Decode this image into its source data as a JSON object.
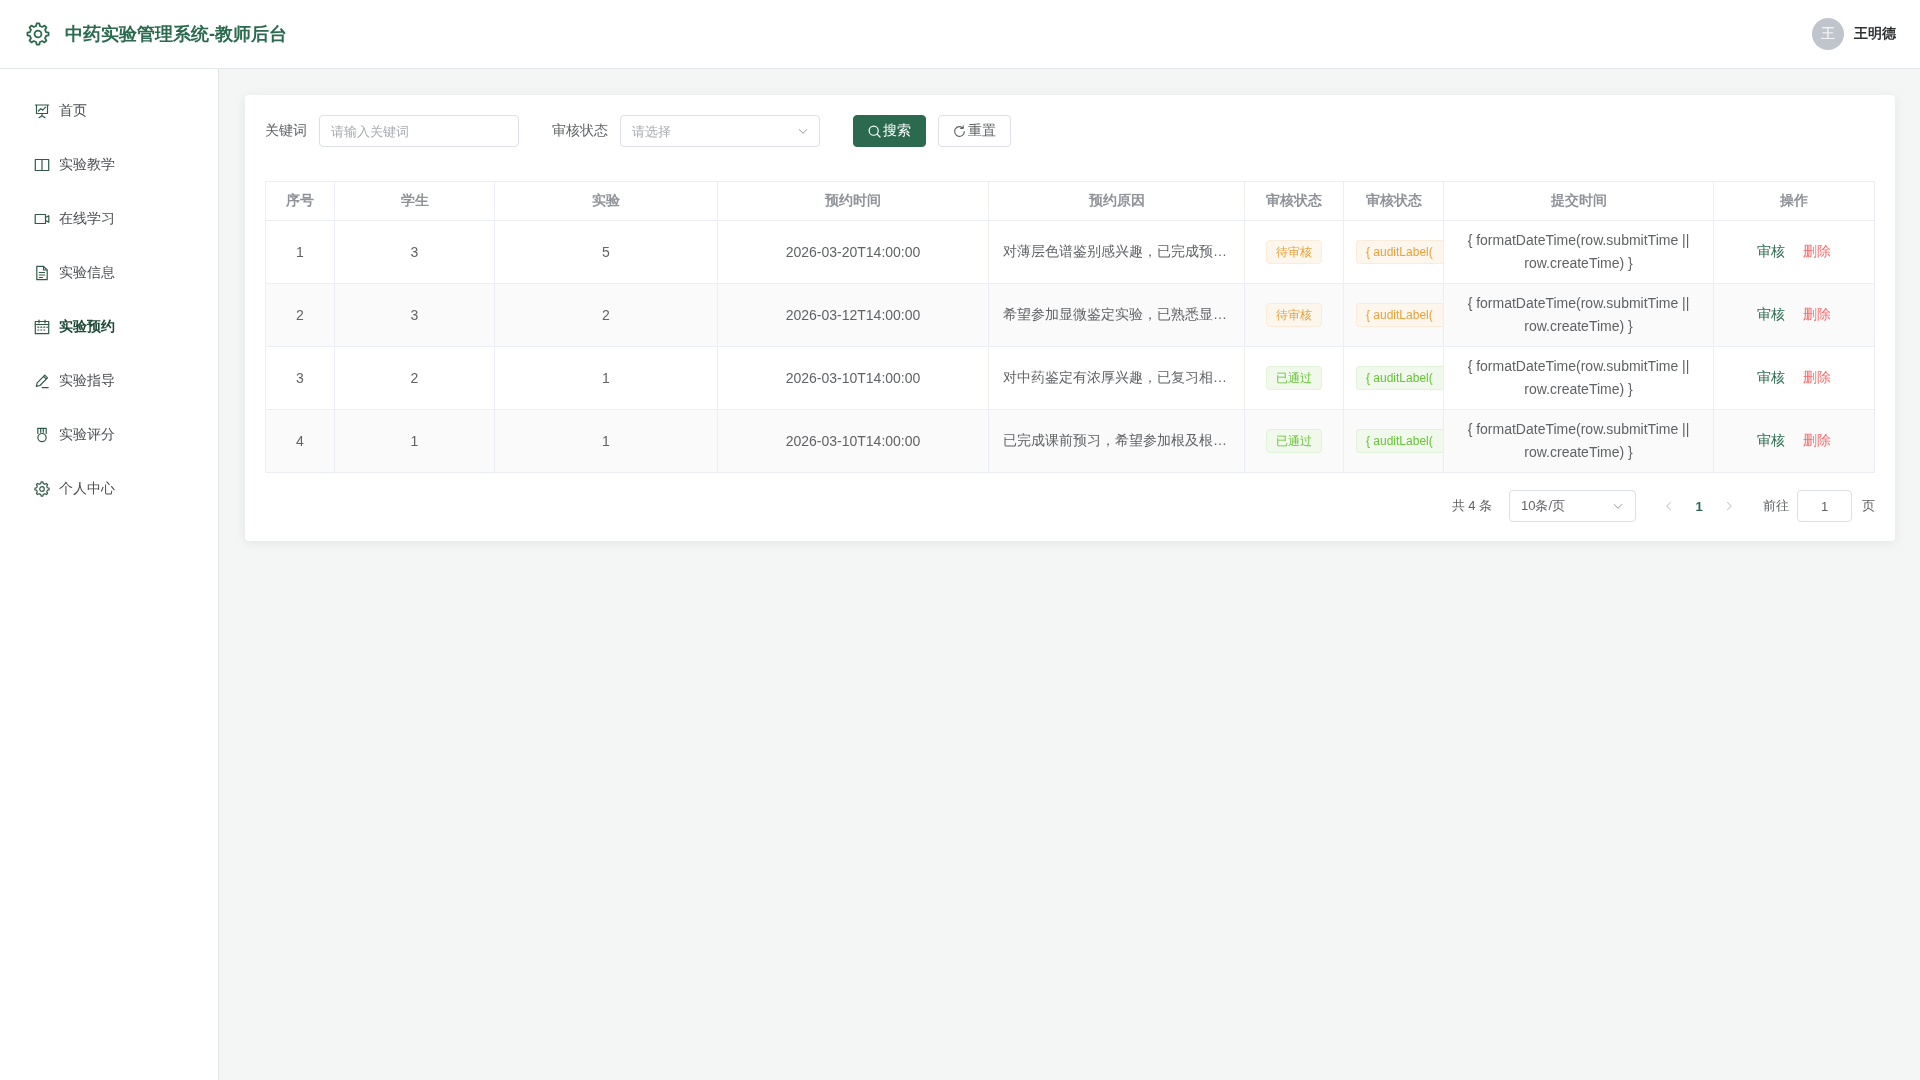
{
  "header": {
    "title": "中药实验管理系统-教师后台",
    "user": {
      "avatar_initial": "王",
      "name": "王明德"
    }
  },
  "sidebar": {
    "items": [
      {
        "label": "首页",
        "selected": false
      },
      {
        "label": "实验教学",
        "selected": false
      },
      {
        "label": "在线学习",
        "selected": false
      },
      {
        "label": "实验信息",
        "selected": false
      },
      {
        "label": "实验预约",
        "selected": true
      },
      {
        "label": "实验指导",
        "selected": false
      },
      {
        "label": "实验评分",
        "selected": false
      },
      {
        "label": "个人中心",
        "selected": false
      }
    ]
  },
  "filters": {
    "keyword": {
      "label": "关键词",
      "placeholder": "请输入关键词"
    },
    "audit_status": {
      "label": "审核状态",
      "placeholder": "请选择"
    },
    "buttons": [
      {
        "label": "搜索",
        "kind": "search"
      },
      {
        "label": "重置",
        "kind": "reset"
      }
    ]
  },
  "table": {
    "columns": [
      "序号",
      "学生",
      "实验",
      "预约时间",
      "预约原因",
      "审核状态",
      "审核状态",
      "提交时间",
      "操作"
    ],
    "rows": [
      {
        "index": "1",
        "student": "3",
        "experiment": "5",
        "reservation_time": "2026-03-20T14:00:00",
        "reason": "对薄层色谱鉴别感兴趣，已完成预…",
        "audit_status": {
          "text": "待审核",
          "kind": "warning"
        },
        "audit_status_2": {
          "text": "{ auditLabel(",
          "kind": "warning"
        },
        "submit_time": "{ formatDateTime(row.submitTime || row.createTime) }",
        "actions": [
          {
            "label": "审核",
            "kind": "review"
          },
          {
            "label": "删除",
            "kind": "delete"
          }
        ]
      },
      {
        "index": "2",
        "student": "3",
        "experiment": "2",
        "reservation_time": "2026-03-12T14:00:00",
        "reason": "希望参加显微鉴定实验，已熟悉显…",
        "audit_status": {
          "text": "待审核",
          "kind": "warning"
        },
        "audit_status_2": {
          "text": "{ auditLabel(",
          "kind": "warning"
        },
        "submit_time": "{ formatDateTime(row.submitTime || row.createTime) }",
        "actions": [
          {
            "label": "审核",
            "kind": "review"
          },
          {
            "label": "删除",
            "kind": "delete"
          }
        ]
      },
      {
        "index": "3",
        "student": "2",
        "experiment": "1",
        "reservation_time": "2026-03-10T14:00:00",
        "reason": "对中药鉴定有浓厚兴趣，已复习相…",
        "audit_status": {
          "text": "已通过",
          "kind": "success"
        },
        "audit_status_2": {
          "text": "{ auditLabel(",
          "kind": "success"
        },
        "submit_time": "{ formatDateTime(row.submitTime || row.createTime) }",
        "actions": [
          {
            "label": "审核",
            "kind": "review"
          },
          {
            "label": "删除",
            "kind": "delete"
          }
        ]
      },
      {
        "index": "4",
        "student": "1",
        "experiment": "1",
        "reservation_time": "2026-03-10T14:00:00",
        "reason": "已完成课前预习，希望参加根及根…",
        "audit_status": {
          "text": "已通过",
          "kind": "success"
        },
        "audit_status_2": {
          "text": "{ auditLabel(",
          "kind": "success"
        },
        "submit_time": "{ formatDateTime(row.submitTime || row.createTime) }",
        "actions": [
          {
            "label": "审核",
            "kind": "review"
          },
          {
            "label": "删除",
            "kind": "delete"
          }
        ]
      }
    ]
  },
  "pagination": {
    "total": "共 4 条",
    "page_size": "10条/页",
    "prev": {
      "disabled": true
    },
    "pages": [
      {
        "label": "1",
        "selected": true
      }
    ],
    "next": {
      "disabled": true
    },
    "goto_label": "前往",
    "goto_value": "1",
    "goto_suffix": "页"
  }
}
